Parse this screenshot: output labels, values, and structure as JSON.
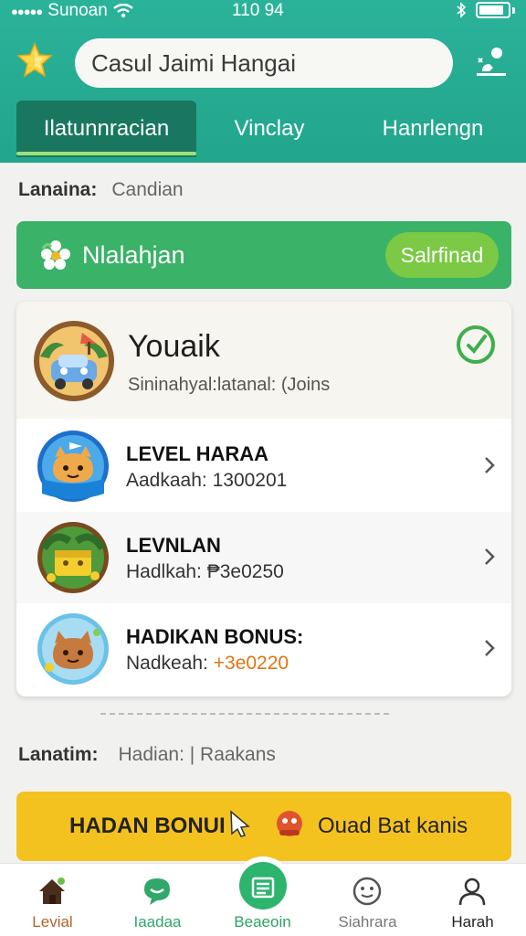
{
  "status_bar": {
    "signal_dots": "●●●●●",
    "carrier": "Sunoan",
    "time": "110 94",
    "bluetooth_icon": "bluetooth-icon",
    "wifi_icon": "wifi-icon",
    "battery_icon": "battery-icon"
  },
  "header": {
    "search_value": "Casul Jaimi Hangai",
    "star_icon": "star-icon",
    "profile_icon": "profile-settings-icon",
    "tabs": [
      {
        "label": "Ilatunnracian",
        "active": true
      },
      {
        "label": "Vinclay",
        "active": false
      },
      {
        "label": "Hanrlengn",
        "active": false
      }
    ]
  },
  "filter_top": {
    "key": "Lanaina:",
    "value": "Candian"
  },
  "banner": {
    "title": "Nlalahjan",
    "button": "Salrfinad",
    "icon": "flower-icon"
  },
  "card": {
    "title": "Youaik",
    "subtitle": "Sininahyal:latanal: (Joins",
    "check_icon": "check-circle-icon",
    "items": [
      {
        "title": "LEVEL HARAA",
        "sub_key": "Aadkaah:",
        "sub_value": "1300201",
        "highlight": false
      },
      {
        "title": "LEVNLAN",
        "sub_key": "Hadlkah:",
        "sub_value": "₱3e0250",
        "highlight": false
      },
      {
        "title": "HADIKAN BONUS:",
        "sub_key": "Nadkeah:",
        "sub_value": "+3e0220",
        "highlight": true
      }
    ]
  },
  "filter_bottom": {
    "key": "Lanatim:",
    "value": "Hadian: | Raakans"
  },
  "bonus_bar": {
    "left_label": "HADAN BONUI",
    "right_label": "Ouad Bat kanis",
    "cursor_icon": "cursor-icon",
    "gift_icon": "gift-icon"
  },
  "bottom_nav": [
    {
      "label": "Levial",
      "icon": "home-icon",
      "active": false
    },
    {
      "label": "Iaadaa",
      "icon": "chat-icon",
      "active": false
    },
    {
      "label": "Beaeoin",
      "icon": "list-icon",
      "active": true
    },
    {
      "label": "Siahrara",
      "icon": "smiley-icon",
      "active": false
    },
    {
      "label": "Harah",
      "icon": "user-icon",
      "active": false
    }
  ],
  "colors": {
    "header": "#22a58d",
    "tab_active": "#19775f",
    "banner": "#3ab267",
    "bonus": "#f4c21e",
    "accent_green": "#2db46d"
  }
}
